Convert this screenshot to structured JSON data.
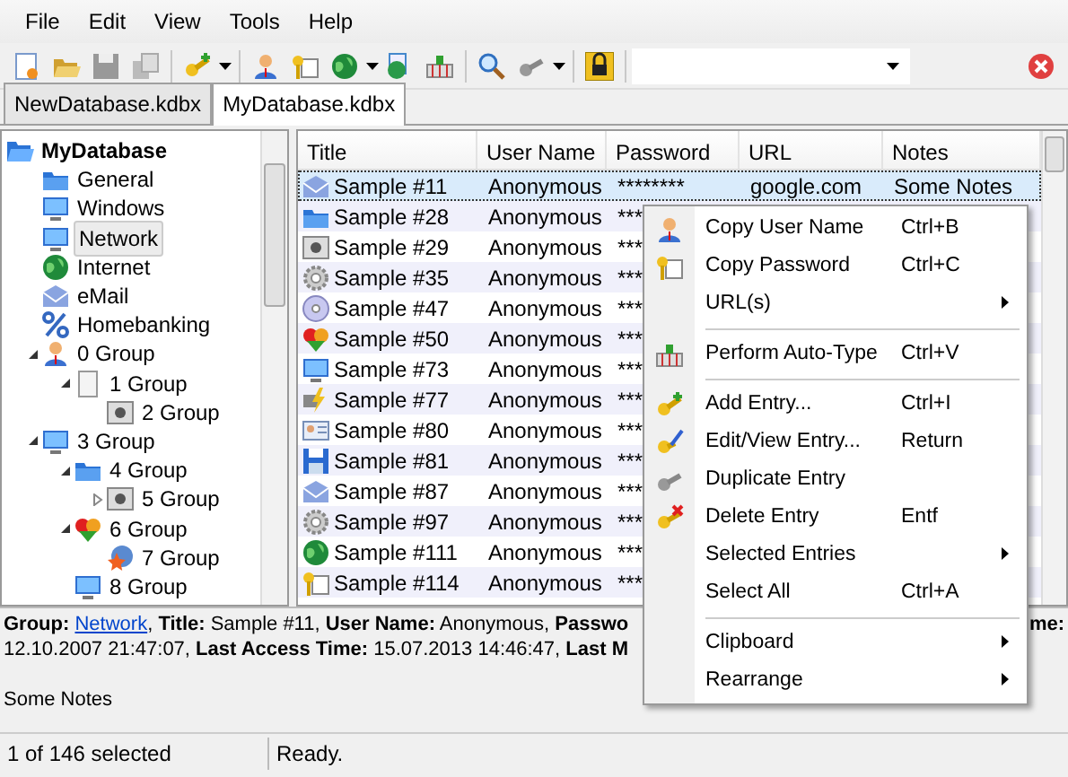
{
  "menu_bar": [
    "File",
    "Edit",
    "View",
    "Tools",
    "Help"
  ],
  "tabs": [
    {
      "label": "NewDatabase.kdbx",
      "selected": false
    },
    {
      "label": "MyDatabase.kdbx",
      "selected": true
    }
  ],
  "group_tree": [
    {
      "label": "MyDatabase",
      "selected": false,
      "children": [
        {
          "label": "General",
          "selected": false
        },
        {
          "label": "Windows",
          "selected": false
        },
        {
          "label": "Network",
          "selected": true
        },
        {
          "label": "Internet",
          "selected": false
        },
        {
          "label": "eMail",
          "selected": false
        },
        {
          "label": "Homebanking",
          "selected": false
        },
        {
          "label": "0 Group",
          "selected": false,
          "expanded": true,
          "children": [
            {
              "label": "1 Group",
              "selected": false,
              "expanded": true,
              "children": [
                {
                  "label": "2 Group",
                  "selected": false
                }
              ]
            }
          ]
        },
        {
          "label": "3 Group",
          "selected": false,
          "expanded": true,
          "children": [
            {
              "label": "4 Group",
              "selected": false,
              "expanded": true,
              "children": [
                {
                  "label": "5 Group",
                  "selected": false,
                  "expanded": false
                }
              ]
            },
            {
              "label": "6 Group",
              "selected": false,
              "expanded": true,
              "children": [
                {
                  "label": "7 Group",
                  "selected": false
                }
              ]
            },
            {
              "label": "8 Group",
              "selected": false
            }
          ]
        }
      ]
    }
  ],
  "entries": {
    "columns": [
      "Title",
      "User Name",
      "Password",
      "URL",
      "Notes"
    ],
    "rows": [
      {
        "title": "Sample #11",
        "user_name": "Anonymous",
        "password": "********",
        "url": "google.com",
        "notes": "Some Notes",
        "selected": true
      },
      {
        "title": "Sample #28",
        "user_name": "Anonymous",
        "password": "***",
        "selected": false
      },
      {
        "title": "Sample #29",
        "user_name": "Anonymous",
        "password": "***",
        "selected": false
      },
      {
        "title": "Sample #35",
        "user_name": "Anonymous",
        "password": "***",
        "selected": false
      },
      {
        "title": "Sample #47",
        "user_name": "Anonymous",
        "password": "***",
        "selected": false
      },
      {
        "title": "Sample #50",
        "user_name": "Anonymous",
        "password": "***",
        "selected": false
      },
      {
        "title": "Sample #73",
        "user_name": "Anonymous",
        "password": "***",
        "selected": false
      },
      {
        "title": "Sample #77",
        "user_name": "Anonymous",
        "password": "***",
        "selected": false
      },
      {
        "title": "Sample #80",
        "user_name": "Anonymous",
        "password": "***",
        "selected": false
      },
      {
        "title": "Sample #81",
        "user_name": "Anonymous",
        "password": "***",
        "selected": false
      },
      {
        "title": "Sample #87",
        "user_name": "Anonymous",
        "password": "***",
        "selected": false
      },
      {
        "title": "Sample #97",
        "user_name": "Anonymous",
        "password": "***",
        "selected": false
      },
      {
        "title": "Sample #111",
        "user_name": "Anonymous",
        "password": "***",
        "selected": false
      },
      {
        "title": "Sample #114",
        "user_name": "Anonymous",
        "password": "***",
        "selected": false
      }
    ]
  },
  "context_menu": [
    {
      "kind": "item",
      "label": "Copy User Name",
      "shortcut": "Ctrl+B"
    },
    {
      "kind": "item",
      "label": "Copy Password",
      "shortcut": "Ctrl+C"
    },
    {
      "kind": "item",
      "label": "URL(s)",
      "submenu": true
    },
    {
      "kind": "separator"
    },
    {
      "kind": "item",
      "label": "Perform Auto-Type",
      "shortcut": "Ctrl+V"
    },
    {
      "kind": "separator"
    },
    {
      "kind": "item",
      "label": "Add Entry...",
      "shortcut": "Ctrl+I"
    },
    {
      "kind": "item",
      "label": "Edit/View Entry...",
      "shortcut": "Return"
    },
    {
      "kind": "item",
      "label": "Duplicate Entry"
    },
    {
      "kind": "item",
      "label": "Delete Entry",
      "shortcut": "Entf"
    },
    {
      "kind": "item",
      "label": "Selected Entries",
      "submenu": true
    },
    {
      "kind": "item",
      "label": "Select All",
      "shortcut": "Ctrl+A"
    },
    {
      "kind": "separator"
    },
    {
      "kind": "item",
      "label": "Clipboard",
      "submenu": true
    },
    {
      "kind": "item",
      "label": "Rearrange",
      "submenu": true
    }
  ],
  "details": {
    "group_label": "Group:",
    "group_link": "Network",
    "line_1": ", **Title:** Sample #11, **User Name:** Anonymous, **Passwo**",
    "line_1_end": "me:",
    "line_2": "12.10.2007 21:47:07, **Last Access Time:** 15.07.2013 14:46:47, **Last M**",
    "notes": "Some Notes"
  },
  "status_bar": [
    "1 of 146 selected",
    "Ready."
  ]
}
